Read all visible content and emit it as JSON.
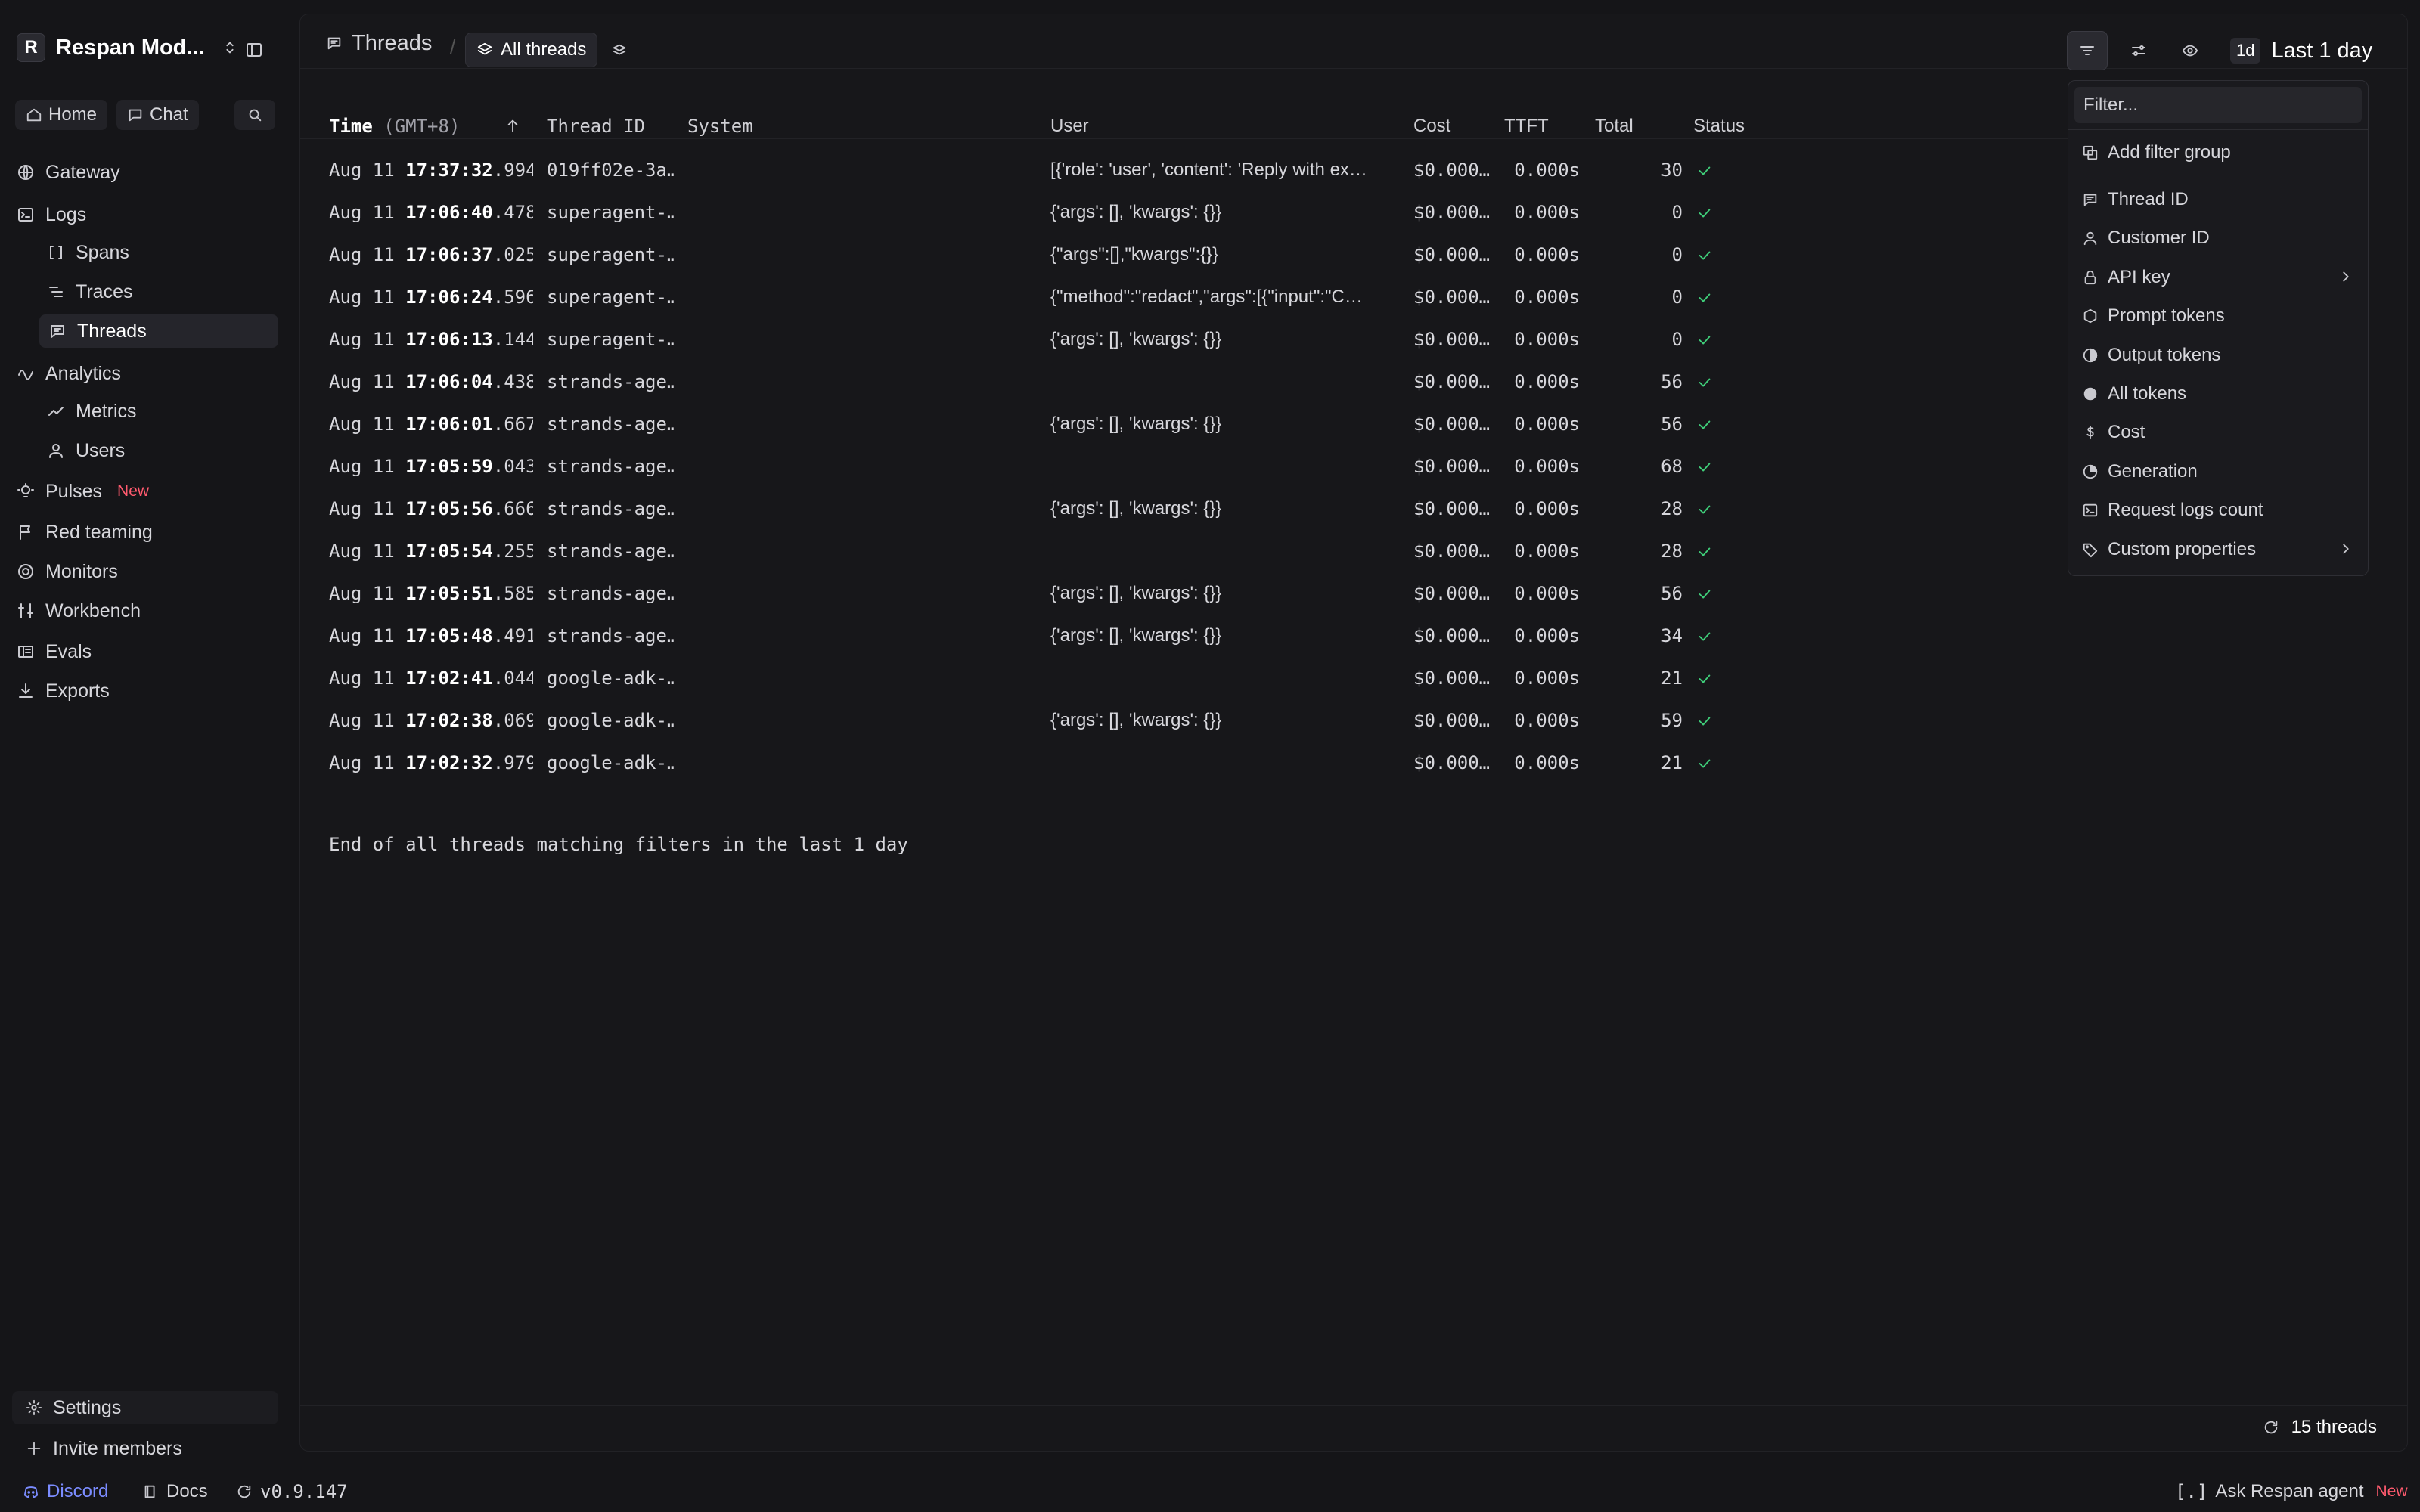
{
  "workspace": {
    "initial": "R",
    "name": "Respan Mod..."
  },
  "quick": {
    "home": "Home",
    "chat": "Chat"
  },
  "nav": {
    "gateway": "Gateway",
    "logs": "Logs",
    "spans": "Spans",
    "traces": "Traces",
    "threads": "Threads",
    "analytics": "Analytics",
    "metrics": "Metrics",
    "users": "Users",
    "pulses": "Pulses",
    "pulses_badge": "New",
    "red_teaming": "Red teaming",
    "monitors": "Monitors",
    "workbench": "Workbench",
    "evals": "Evals",
    "exports": "Exports",
    "settings": "Settings",
    "invite": "Invite members"
  },
  "footer": {
    "discord": "Discord",
    "docs": "Docs",
    "version": "v0.9.147",
    "ask": "Ask Respan agent",
    "ask_badge": "New"
  },
  "breadcrumb": {
    "threads": "Threads",
    "view": "All threads"
  },
  "toolbar": {
    "range_pill": "1d",
    "range_label": "Last 1 day"
  },
  "table": {
    "headers": {
      "time": "Time",
      "tz": "(GMT+8)",
      "thread_id": "Thread ID",
      "system": "System",
      "user": "User",
      "cost": "Cost",
      "ttft": "TTFT",
      "total": "Total",
      "status": "Status"
    },
    "rows": [
      {
        "date": "Aug 11",
        "hms": "17:37:32",
        "ms": ".994",
        "thread_id": "019ff02e-3a…",
        "user": "[{'role': 'user', 'content': 'Reply with ex…",
        "cost": "$0.000…",
        "ttft": "0.000s",
        "total": "30"
      },
      {
        "date": "Aug 11",
        "hms": "17:06:40",
        "ms": ".478",
        "thread_id": "superagent-…",
        "user": "{'args': [], 'kwargs': {}}",
        "cost": "$0.000…",
        "ttft": "0.000s",
        "total": "0"
      },
      {
        "date": "Aug 11",
        "hms": "17:06:37",
        "ms": ".025",
        "thread_id": "superagent-…",
        "user": "{\"args\":[],\"kwargs\":{}}",
        "cost": "$0.000…",
        "ttft": "0.000s",
        "total": "0"
      },
      {
        "date": "Aug 11",
        "hms": "17:06:24",
        "ms": ".596",
        "thread_id": "superagent-…",
        "user": "{\"method\":\"redact\",\"args\":[{\"input\":\"C…",
        "cost": "$0.000…",
        "ttft": "0.000s",
        "total": "0"
      },
      {
        "date": "Aug 11",
        "hms": "17:06:13",
        "ms": ".144",
        "thread_id": "superagent-…",
        "user": "{'args': [], 'kwargs': {}}",
        "cost": "$0.000…",
        "ttft": "0.000s",
        "total": "0"
      },
      {
        "date": "Aug 11",
        "hms": "17:06:04",
        "ms": ".438",
        "thread_id": "strands-age…",
        "user": "",
        "cost": "$0.000…",
        "ttft": "0.000s",
        "total": "56"
      },
      {
        "date": "Aug 11",
        "hms": "17:06:01",
        "ms": ".667",
        "thread_id": "strands-age…",
        "user": "{'args': [], 'kwargs': {}}",
        "cost": "$0.000…",
        "ttft": "0.000s",
        "total": "56"
      },
      {
        "date": "Aug 11",
        "hms": "17:05:59",
        "ms": ".043",
        "thread_id": "strands-age…",
        "user": "",
        "cost": "$0.000…",
        "ttft": "0.000s",
        "total": "68"
      },
      {
        "date": "Aug 11",
        "hms": "17:05:56",
        "ms": ".666",
        "thread_id": "strands-age…",
        "user": "{'args': [], 'kwargs': {}}",
        "cost": "$0.000…",
        "ttft": "0.000s",
        "total": "28"
      },
      {
        "date": "Aug 11",
        "hms": "17:05:54",
        "ms": ".255",
        "thread_id": "strands-age…",
        "user": "",
        "cost": "$0.000…",
        "ttft": "0.000s",
        "total": "28"
      },
      {
        "date": "Aug 11",
        "hms": "17:05:51",
        "ms": ".585",
        "thread_id": "strands-age…",
        "user": "{'args': [], 'kwargs': {}}",
        "cost": "$0.000…",
        "ttft": "0.000s",
        "total": "56"
      },
      {
        "date": "Aug 11",
        "hms": "17:05:48",
        "ms": ".491",
        "thread_id": "strands-age…",
        "user": "{'args': [], 'kwargs': {}}",
        "cost": "$0.000…",
        "ttft": "0.000s",
        "total": "34"
      },
      {
        "date": "Aug 11",
        "hms": "17:02:41",
        "ms": ".044",
        "thread_id": "google-adk-…",
        "user": "",
        "cost": "$0.000…",
        "ttft": "0.000s",
        "total": "21"
      },
      {
        "date": "Aug 11",
        "hms": "17:02:38",
        "ms": ".069",
        "thread_id": "google-adk-…",
        "user": "{'args': [], 'kwargs': {}}",
        "cost": "$0.000…",
        "ttft": "0.000s",
        "total": "59"
      },
      {
        "date": "Aug 11",
        "hms": "17:02:32",
        "ms": ".979",
        "thread_id": "google-adk-…",
        "user": "",
        "cost": "$0.000…",
        "ttft": "0.000s",
        "total": "21"
      }
    ],
    "end_message": "End of all threads matching filters in the last 1 day",
    "count": "15 threads"
  },
  "filter_menu": {
    "placeholder": "Filter...",
    "add_group": "Add filter group",
    "items": [
      {
        "label": "Thread ID",
        "icon": "message-square-icon"
      },
      {
        "label": "Customer ID",
        "icon": "user-icon"
      },
      {
        "label": "API key",
        "icon": "lock-icon",
        "submenu": true
      },
      {
        "label": "Prompt tokens",
        "icon": "hexagon-icon"
      },
      {
        "label": "Output tokens",
        "icon": "half-circle-icon"
      },
      {
        "label": "All tokens",
        "icon": "filled-circle-icon"
      },
      {
        "label": "Cost",
        "icon": "dollar-icon"
      },
      {
        "label": "Generation",
        "icon": "generation-icon"
      },
      {
        "label": "Request logs count",
        "icon": "terminal-icon"
      },
      {
        "label": "Custom properties",
        "icon": "tag-icon",
        "submenu": true
      }
    ]
  },
  "colors": {
    "background": "#151518",
    "accent_new": "#ff5a6e",
    "status_ok": "#3fcf7a",
    "discord": "#7b8cff"
  }
}
